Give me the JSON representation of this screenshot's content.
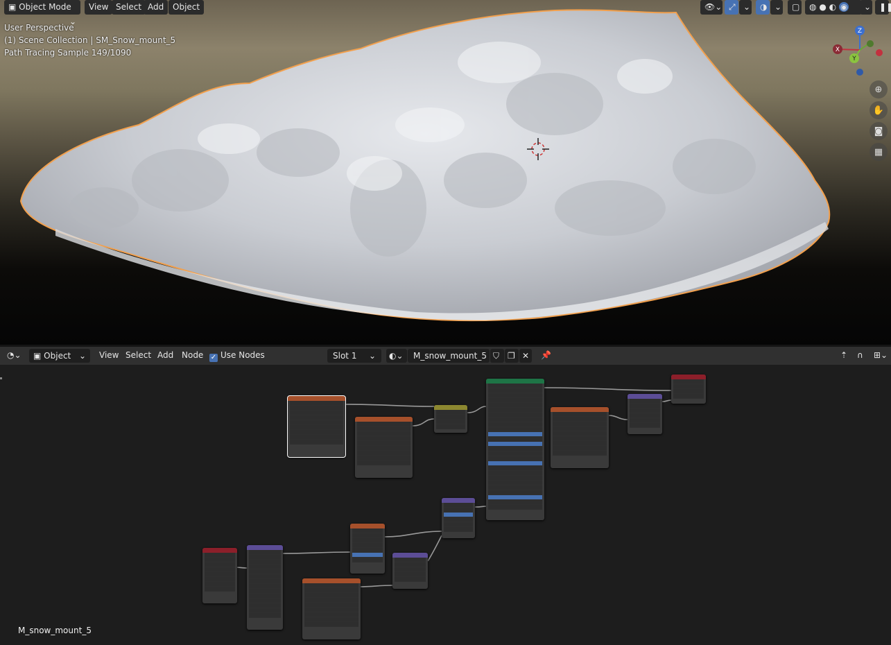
{
  "viewport": {
    "mode_label": "Object Mode",
    "menu": [
      "View",
      "Select",
      "Add",
      "Object"
    ],
    "overlay": {
      "line1": "User Perspective",
      "line2": "(1) Scene Collection | SM_Snow_mount_5",
      "line3": "Path Tracing Sample 149/1090"
    },
    "gizmo_axes": {
      "z": "Z",
      "y": "Y",
      "x": "X"
    },
    "nav_icons": [
      "zoom-icon",
      "hand-pan-icon",
      "camera-icon",
      "grid-icon"
    ]
  },
  "node_editor": {
    "editor_type": "Object",
    "menu": [
      "View",
      "Select",
      "Add",
      "Node"
    ],
    "use_nodes_label": "Use Nodes",
    "slot": "Slot 1",
    "material_name": "M_snow_mount_5",
    "editor_footer_name": "M_snow_mount_5"
  },
  "colors": {
    "accent": "#4772b3",
    "selection_outline": "#f2a04d",
    "node_texture_header": "#a6502b",
    "node_shader_header": "#1e7446",
    "node_vector_header": "#5c4d96",
    "node_output_header": "#8c1f2a",
    "node_color_header": "#8c8730"
  }
}
